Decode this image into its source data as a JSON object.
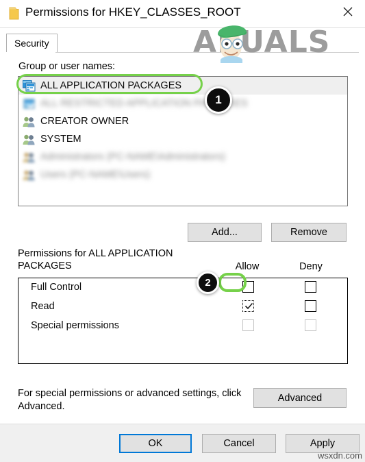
{
  "window": {
    "title": "Permissions for HKEY_CLASSES_ROOT",
    "icon": "folder-icon",
    "close_label": "✕"
  },
  "tabs": [
    {
      "label": "Security",
      "active": true
    }
  ],
  "groups_section": {
    "label": "Group or user names:",
    "items": [
      {
        "label": "ALL APPLICATION PACKAGES",
        "icon": "app-package-icon",
        "selected": true,
        "blurred": false
      },
      {
        "label": "ALL RESTRICTED APPLICATION PACKAGES",
        "icon": "app-package-icon",
        "selected": false,
        "blurred": true
      },
      {
        "label": "CREATOR OWNER",
        "icon": "users-group-icon",
        "selected": false,
        "blurred": false
      },
      {
        "label": "SYSTEM",
        "icon": "users-group-icon",
        "selected": false,
        "blurred": false
      },
      {
        "label": "Administrators (PC-NAME\\Administrators)",
        "icon": "users-group-icon",
        "selected": false,
        "blurred": true
      },
      {
        "label": "Users (PC-NAME\\Users)",
        "icon": "users-group-icon",
        "selected": false,
        "blurred": true
      }
    ],
    "add_label": "Add...",
    "remove_label": "Remove"
  },
  "permissions_section": {
    "header": "Permissions for ALL APPLICATION PACKAGES",
    "columns": {
      "allow": "Allow",
      "deny": "Deny"
    },
    "rows": [
      {
        "name": "Full Control",
        "allow": false,
        "deny": false,
        "allow_disabled": false,
        "deny_disabled": false,
        "allow_focused": false
      },
      {
        "name": "Read",
        "allow": true,
        "deny": false,
        "allow_disabled": false,
        "deny_disabled": false,
        "allow_focused": true
      },
      {
        "name": "Special permissions",
        "allow": false,
        "deny": false,
        "allow_disabled": true,
        "deny_disabled": true,
        "allow_focused": false
      }
    ]
  },
  "footer": {
    "note": "For special permissions or advanced settings, click Advanced.",
    "advanced_label": "Advanced"
  },
  "command_bar": {
    "ok_label": "OK",
    "cancel_label": "Cancel",
    "apply_label": "Apply"
  },
  "annotations": {
    "badge_1": "1",
    "badge_2": "2",
    "highlight_color": "#76d14a",
    "badge_color": "#0d0d0d",
    "focus_color": "#0078d7"
  },
  "watermarks": {
    "brand": "APUALS",
    "brand_full": "APPUALS",
    "site": "wsxdn.com"
  }
}
